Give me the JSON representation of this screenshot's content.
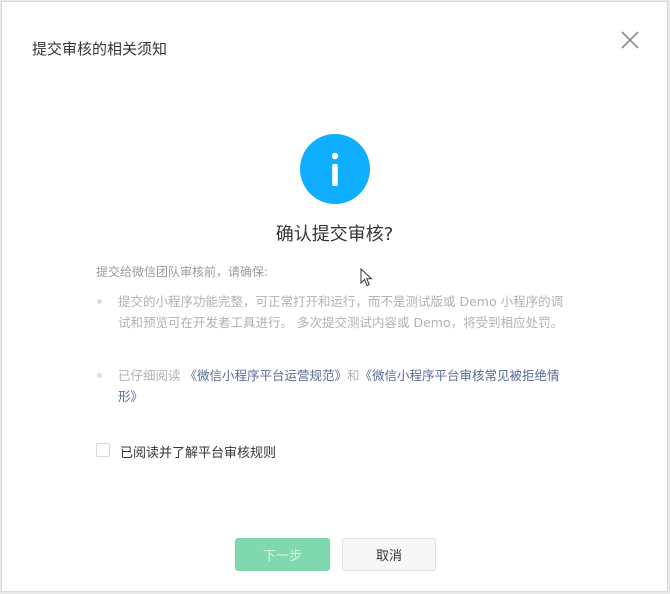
{
  "dialog": {
    "title": "提交审核的相关须知",
    "close_icon": "close-icon",
    "info_icon": "info-icon",
    "headline": "确认提交审核?",
    "intro": "提交给微信团队审核前，请确保:",
    "items": [
      {
        "text": "提交的小程序功能完整，可正常打开和运行，而不是测试版或 Demo 小程序的调试和预览可在开发者工具进行。 多次提交测试内容或 Demo，将受到相应处罚。"
      },
      {
        "prefix": "已仔细阅读 ",
        "link1": "《微信小程序平台运营规范》",
        "middle": "和",
        "link2": "《微信小程序平台审核常见被拒绝情形》"
      }
    ],
    "checkbox": {
      "label": "已阅读并了解平台审核规则",
      "checked": false
    },
    "buttons": {
      "next": "下一步",
      "cancel": "取消"
    },
    "colors": {
      "accent": "#10aeff",
      "link": "#576b95",
      "primary_disabled": "#7fd8ae"
    }
  }
}
